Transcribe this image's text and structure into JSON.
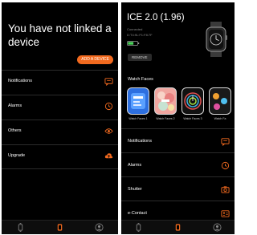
{
  "left_screen": {
    "headline": "You have not linked a device",
    "add_button": "ADD A DEVICE",
    "menu": [
      {
        "label": "Notifications",
        "icon": "message-icon"
      },
      {
        "label": "Alarms",
        "icon": "clock-icon"
      },
      {
        "label": "Others",
        "icon": "eye-icon"
      },
      {
        "label": "Upgrade",
        "icon": "cloud-upload-icon"
      }
    ]
  },
  "right_screen": {
    "device_name": "ICE 2.0 (1.96)",
    "status": "Connected",
    "mac": "D:T4:9L:F1:F8:7F",
    "battery_level": 0.6,
    "remove_button": "REMOVE",
    "watch_faces_title": "Watch Faces",
    "watch_faces": [
      {
        "label": "Watch Faces 1"
      },
      {
        "label": "Watch Faces 2"
      },
      {
        "label": "Watch Faces 3"
      },
      {
        "label": "Watch Fa"
      }
    ],
    "menu": [
      {
        "label": "Notifications",
        "icon": "message-icon"
      },
      {
        "label": "Alarms",
        "icon": "clock-icon"
      },
      {
        "label": "Shutter",
        "icon": "camera-icon"
      },
      {
        "label": "e-Contact",
        "icon": "contact-card-icon"
      }
    ]
  },
  "bottom_nav": [
    {
      "icon": "watch-icon",
      "active": false
    },
    {
      "icon": "device-icon",
      "active": true
    },
    {
      "icon": "profile-icon",
      "active": false
    }
  ],
  "colors": {
    "accent": "#f26a1f",
    "background": "#000000",
    "divider": "#2b2b2b"
  }
}
